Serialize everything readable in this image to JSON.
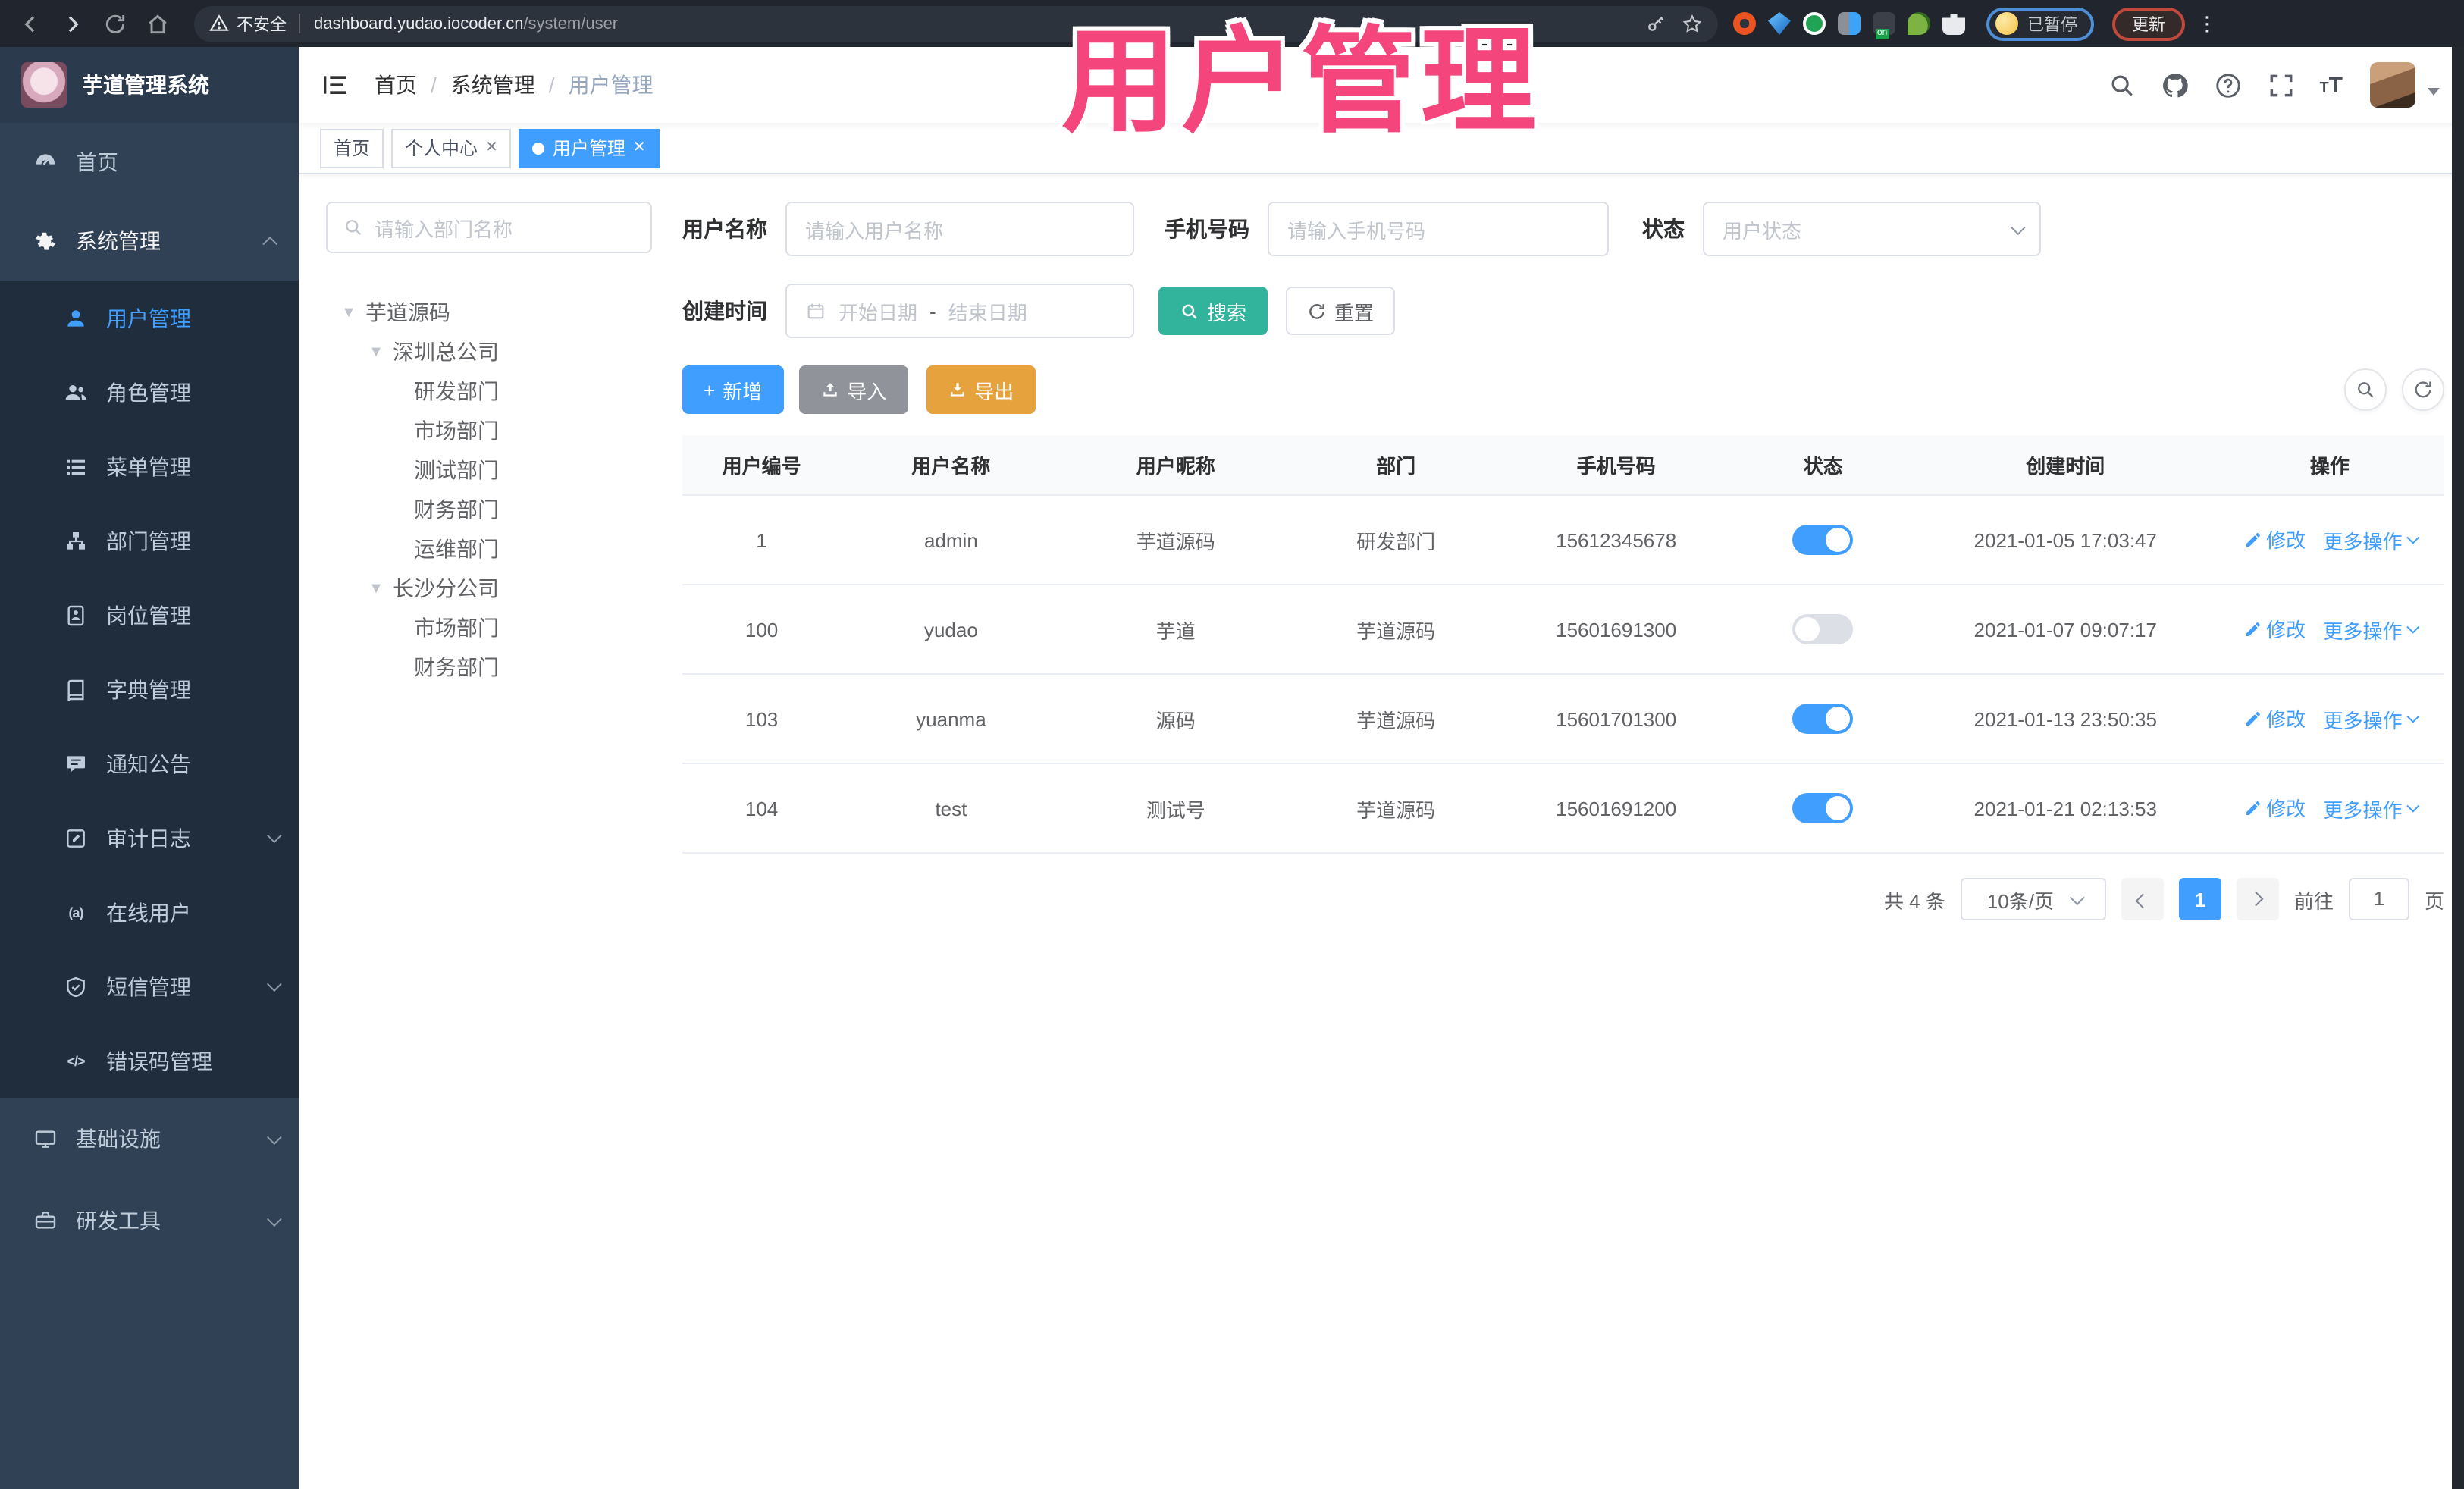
{
  "browser": {
    "security_label": "不安全",
    "url_host": "dashboard.yudao.iocoder.cn",
    "url_path": "/system/user",
    "paused_label": "已暂停",
    "update_label": "更新"
  },
  "overlay": {
    "title": "用户管理",
    "color": "#f5457d"
  },
  "sidebar": {
    "app_title": "芋道管理系统",
    "home": "首页",
    "system": "系统管理",
    "items": [
      "用户管理",
      "角色管理",
      "菜单管理",
      "部门管理",
      "岗位管理",
      "字典管理",
      "通知公告",
      "审计日志",
      "在线用户",
      "短信管理",
      "错误码管理"
    ],
    "infra": "基础设施",
    "dev": "研发工具"
  },
  "header": {
    "breadcrumb": [
      "首页",
      "系统管理",
      "用户管理"
    ]
  },
  "tags": {
    "home": "首页",
    "profile": "个人中心",
    "user": "用户管理"
  },
  "dept": {
    "search_placeholder": "请输入部门名称",
    "tree": [
      "芋道源码",
      "深圳总公司",
      "研发部门",
      "市场部门",
      "测试部门",
      "财务部门",
      "运维部门",
      "长沙分公司",
      "市场部门",
      "财务部门"
    ]
  },
  "filters": {
    "username_label": "用户名称",
    "username_placeholder": "请输入用户名称",
    "mobile_label": "手机号码",
    "mobile_placeholder": "请输入手机号码",
    "status_label": "状态",
    "status_placeholder": "用户状态",
    "time_label": "创建时间",
    "start_placeholder": "开始日期",
    "range_separator": "-",
    "end_placeholder": "结束日期",
    "search": "搜索",
    "reset": "重置"
  },
  "toolbar": {
    "add": "新增",
    "import": "导入",
    "export": "导出"
  },
  "table": {
    "headers": [
      "用户编号",
      "用户名称",
      "用户昵称",
      "部门",
      "手机号码",
      "状态",
      "创建时间",
      "操作"
    ],
    "edit": "修改",
    "more": "更多操作",
    "rows": [
      {
        "id": "1",
        "username": "admin",
        "nickname": "芋道源码",
        "dept": "研发部门",
        "mobile": "15612345678",
        "status": true,
        "created": "2021-01-05 17:03:47"
      },
      {
        "id": "100",
        "username": "yudao",
        "nickname": "芋道",
        "dept": "芋道源码",
        "mobile": "15601691300",
        "status": false,
        "created": "2021-01-07 09:07:17"
      },
      {
        "id": "103",
        "username": "yuanma",
        "nickname": "源码",
        "dept": "芋道源码",
        "mobile": "15601701300",
        "status": true,
        "created": "2021-01-13 23:50:35"
      },
      {
        "id": "104",
        "username": "test",
        "nickname": "测试号",
        "dept": "芋道源码",
        "mobile": "15601691200",
        "status": true,
        "created": "2021-01-21 02:13:53"
      }
    ]
  },
  "pagination": {
    "total": "共 4 条",
    "page_size": "10条/页",
    "page": "1",
    "goto": "前往",
    "goto_value": "1",
    "unit": "页"
  },
  "colors": {
    "primary": "#409eff",
    "search_teal": "#31b39c",
    "warning": "#e6a23c",
    "info": "#909399",
    "sidebar_bg": "#304156",
    "submenu_bg": "#1f2d3d",
    "overlay_pink": "#f5457d"
  }
}
